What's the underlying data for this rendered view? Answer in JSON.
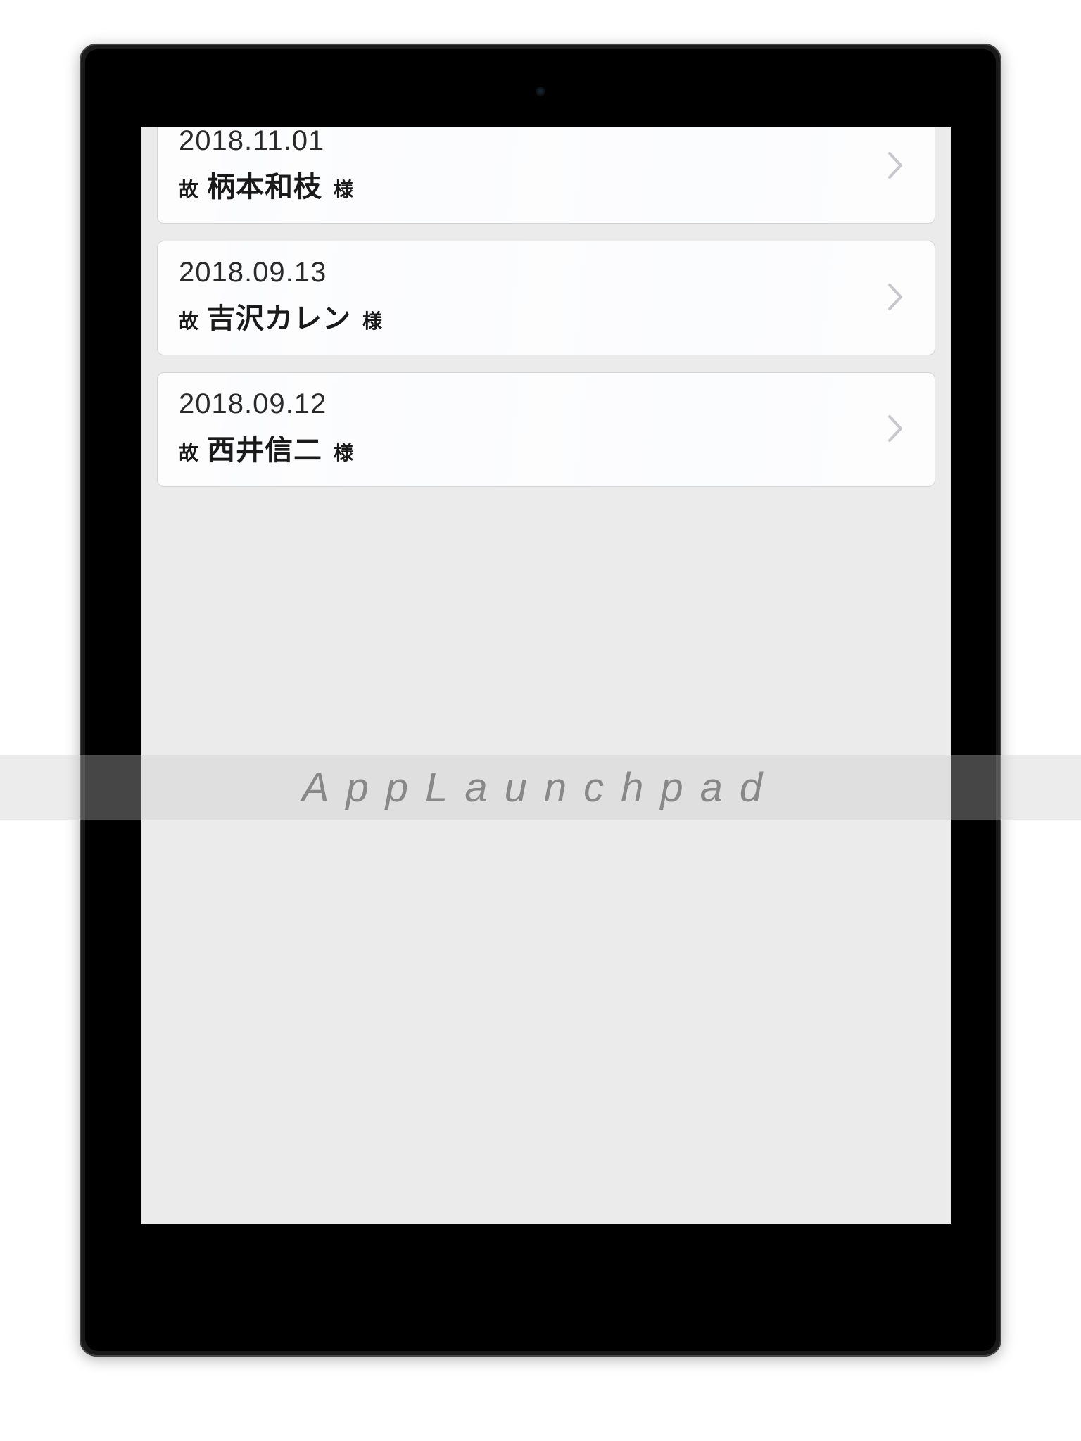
{
  "watermark": "AppLaunchpad",
  "entries": [
    {
      "date": "2018.11.01",
      "prefix": "故",
      "name": "柄本和枝",
      "suffix": "様"
    },
    {
      "date": "2018.09.13",
      "prefix": "故",
      "name": "吉沢カレン",
      "suffix": "様"
    },
    {
      "date": "2018.09.12",
      "prefix": "故",
      "name": "西井信二",
      "suffix": "様"
    }
  ],
  "colors": {
    "screen_bg": "#ebebeb",
    "card_bg": "#fdfdfe",
    "card_border": "#d4d4d4",
    "text_dark": "#1a1a1a",
    "chevron": "#c7c7cc"
  }
}
